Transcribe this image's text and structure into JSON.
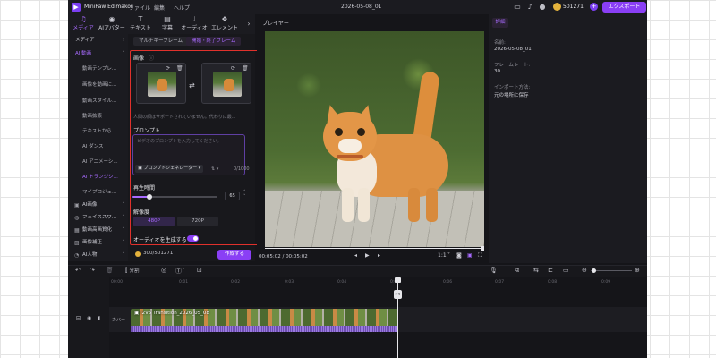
{
  "titlebar": {
    "app_name": "MiniPaw Edimakor",
    "menus": [
      "ファイル",
      "編集",
      "ヘルプ"
    ],
    "project_name": "2026-05-08_01",
    "credits": "501271",
    "export_label": "エクスポート"
  },
  "toolbar": {
    "tools": [
      {
        "icon": "media-icon",
        "label": "メディア"
      },
      {
        "icon": "ai-avatar-icon",
        "label": "AIアバター"
      },
      {
        "icon": "text-icon",
        "label": "テキスト"
      },
      {
        "icon": "subtitle-icon",
        "label": "字幕"
      },
      {
        "icon": "audio-icon",
        "label": "オーディオ"
      },
      {
        "icon": "element-icon",
        "label": "エレメント"
      }
    ]
  },
  "sidebar": {
    "items": [
      {
        "label": "メディア",
        "level": "top"
      },
      {
        "label": "AI 動画",
        "level": "top",
        "active": true
      },
      {
        "label": "動画テンプレ...",
        "level": "sub"
      },
      {
        "label": "画像を動画に...",
        "level": "sub"
      },
      {
        "label": "動画スタイル...",
        "level": "sub"
      },
      {
        "label": "動画拡張",
        "level": "sub"
      },
      {
        "label": "テキストから...",
        "level": "sub"
      },
      {
        "label": "AI ダンス",
        "level": "sub"
      },
      {
        "label": "AI アニメーシ...",
        "level": "sub"
      },
      {
        "label": "AI トランジシ...",
        "level": "sub",
        "active": true
      },
      {
        "label": "マイプロジェ...",
        "level": "sub"
      },
      {
        "label": "AI画像",
        "level": "top"
      },
      {
        "label": "フェイススワ...",
        "level": "top"
      },
      {
        "label": "動画高画質化",
        "level": "top"
      },
      {
        "label": "画像補正",
        "level": "top"
      },
      {
        "label": "AI人物",
        "level": "top"
      }
    ]
  },
  "panel": {
    "tabs": [
      "マルチキーフレーム",
      "開始・終了フレーム"
    ],
    "image_section": "画像",
    "hint": "人間の顔はサポートされていません。代わりに最...",
    "prompt_title": "プロンプト",
    "prompt_placeholder": "ビデオのプロンプトを入力してください。",
    "prompt_generator": "プロンプトジェネレーター",
    "prompt_count": "0/1000",
    "duration_title": "再生時間",
    "duration_value": "6S",
    "duration_fraction": 0.2,
    "resolution_title": "解像度",
    "resolutions": [
      "480P",
      "720P"
    ],
    "audio_toggle_label": "オーディオを生成する",
    "cost": "300/501271",
    "create_label": "作成する"
  },
  "player": {
    "title": "プレイヤー",
    "time_current": "00:05:02",
    "time_total": "00:05:02",
    "speed": "1:1"
  },
  "info": {
    "tab": "詳細",
    "name_label": "名前:",
    "name_value": "2026-05-08_01",
    "framerate_label": "フレームレート:",
    "framerate_value": "30",
    "import_label": "インポート方法:",
    "import_value": "元の場所に保存"
  },
  "timeline": {
    "split_label": "分割",
    "ticks": [
      "00:00",
      "0:01",
      "0:02",
      "0:03",
      "0:04",
      "0:05",
      "0:06",
      "0:07",
      "0:08",
      "0:09"
    ],
    "clip_name": "I2V5 Transition_2026_05_08",
    "cover_label": "カバー"
  },
  "colors": {
    "accent": "#8a3ff5",
    "highlight_box": "#e0312c",
    "background": "#151519"
  }
}
